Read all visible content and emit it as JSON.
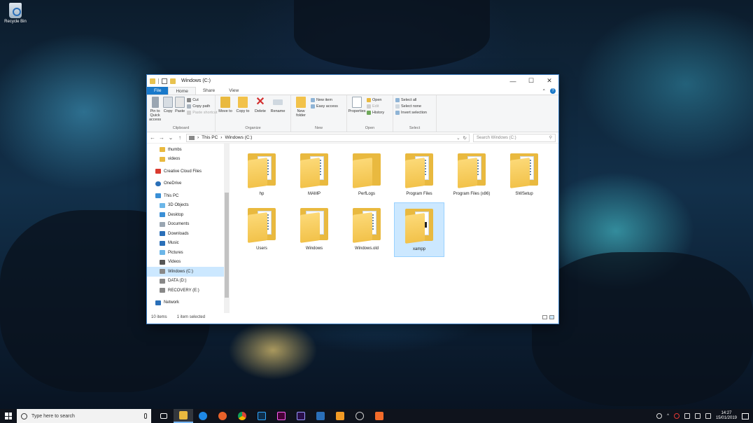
{
  "desktop": {
    "icon_label": "Recycle Bin"
  },
  "window": {
    "title": "Windows (C:)",
    "controls": {
      "minimize": "—",
      "maximize": "☐",
      "close": "✕"
    },
    "tabs": [
      {
        "label": "File"
      },
      {
        "label": "Home"
      },
      {
        "label": "Share"
      },
      {
        "label": "View"
      }
    ],
    "ribbon": {
      "clipboard": {
        "group_label": "Clipboard",
        "pin": "Pin to Quick access",
        "copy": "Copy",
        "paste": "Paste",
        "cut": "Cut",
        "copy_path": "Copy path",
        "paste_shortcut": "Paste shortcut"
      },
      "organize": {
        "group_label": "Organize",
        "move_to": "Move to",
        "copy_to": "Copy to",
        "delete": "Delete",
        "rename": "Rename"
      },
      "new": {
        "group_label": "New",
        "new_folder": "New folder",
        "new_item": "New item",
        "easy_access": "Easy access"
      },
      "open": {
        "group_label": "Open",
        "properties": "Properties",
        "open": "Open",
        "edit": "Edit",
        "history": "History"
      },
      "select": {
        "group_label": "Select",
        "select_all": "Select all",
        "select_none": "Select none",
        "invert": "Invert selection"
      }
    },
    "address": {
      "crumbs": [
        "This PC",
        "Windows (C:)"
      ],
      "search_placeholder": "Search Windows (C:)"
    },
    "nav_pane": [
      {
        "label": "thumbs",
        "icon": "folder-icon",
        "color": "#e9b93f"
      },
      {
        "label": "videos",
        "icon": "folder-icon",
        "color": "#e9b93f"
      },
      {
        "label": "Creative Cloud Files",
        "icon": "creative-cloud-icon",
        "color": "#da3b2f"
      },
      {
        "label": "OneDrive",
        "icon": "cloud-icon",
        "color": "#2a6fb8"
      },
      {
        "label": "This PC",
        "icon": "computer-icon",
        "color": "#3a8fd6"
      },
      {
        "label": "3D Objects",
        "icon": "cube-icon",
        "color": "#6bb6e8"
      },
      {
        "label": "Desktop",
        "icon": "desktop-icon",
        "color": "#3a8fd6"
      },
      {
        "label": "Documents",
        "icon": "documents-icon",
        "color": "#9aa6b2"
      },
      {
        "label": "Downloads",
        "icon": "download-icon",
        "color": "#2a6fb8"
      },
      {
        "label": "Music",
        "icon": "music-icon",
        "color": "#2a6fb8"
      },
      {
        "label": "Pictures",
        "icon": "pictures-icon",
        "color": "#6bb6e8"
      },
      {
        "label": "Videos",
        "icon": "videos-icon",
        "color": "#555"
      },
      {
        "label": "Windows (C:)",
        "icon": "drive-icon",
        "color": "#888"
      },
      {
        "label": "DATA (D:)",
        "icon": "drive-icon",
        "color": "#888"
      },
      {
        "label": "RECOVERY (E:)",
        "icon": "drive-icon",
        "color": "#888"
      },
      {
        "label": "Network",
        "icon": "network-icon",
        "color": "#2a6fb8"
      }
    ],
    "files": [
      {
        "name": "hp"
      },
      {
        "name": "MAMP"
      },
      {
        "name": "PerfLogs"
      },
      {
        "name": "Program Files"
      },
      {
        "name": "Program Files (x86)"
      },
      {
        "name": "SWSetup"
      },
      {
        "name": "Users"
      },
      {
        "name": "Windows"
      },
      {
        "name": "Windows.old"
      },
      {
        "name": "xampp"
      }
    ],
    "status": {
      "count": "10 items",
      "selected": "1 item selected"
    }
  },
  "taskbar": {
    "search_placeholder": "Type here to search",
    "apps": [
      {
        "name": "task-view-icon",
        "color": "transparent"
      },
      {
        "name": "file-explorer-icon",
        "color": "#e9b93f"
      },
      {
        "name": "edge-icon",
        "color": "#1e88e5"
      },
      {
        "name": "firefox-icon",
        "color": "#e8622a"
      },
      {
        "name": "chrome-icon",
        "color": "#4caf50"
      },
      {
        "name": "photoshop-icon",
        "color": "#0f2e4a"
      },
      {
        "name": "adobe-xd-icon",
        "color": "#470137"
      },
      {
        "name": "premiere-icon",
        "color": "#2a0f4a"
      },
      {
        "name": "visual-studio-icon",
        "color": "#2a6fb8"
      },
      {
        "name": "sublime-icon",
        "color": "#f29b25"
      },
      {
        "name": "app-icon",
        "color": "#cccccc"
      },
      {
        "name": "xampp-icon",
        "color": "#f26b2a"
      }
    ],
    "clock_time": "14:27",
    "clock_date": "15/01/2019"
  }
}
